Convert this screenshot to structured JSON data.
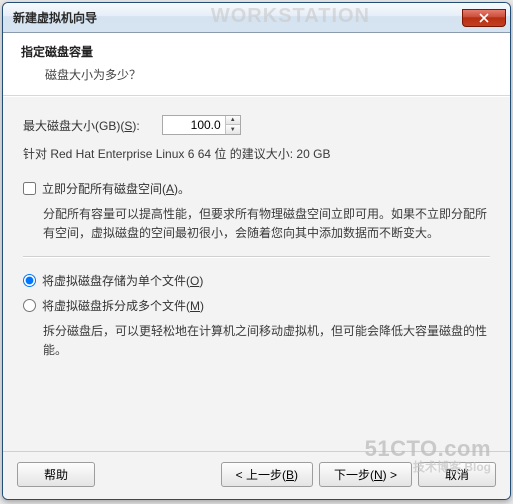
{
  "window": {
    "title": "新建虚拟机向导",
    "ghost": "WORKSTATION"
  },
  "header": {
    "heading": "指定磁盘容量",
    "sub": "磁盘大小为多少？"
  },
  "disk": {
    "label_prefix": "最大磁盘大小(GB)(",
    "label_hotkey": "S",
    "label_suffix": "):",
    "value": "100.0",
    "recommend": "针对 Red Hat Enterprise Linux 6 64 位 的建议大小: 20 GB"
  },
  "allocate": {
    "label_prefix": "立即分配所有磁盘空间(",
    "label_hotkey": "A",
    "label_suffix": ")。",
    "desc": "分配所有容量可以提高性能，但要求所有物理磁盘空间立即可用。如果不立即分配所有空间，虚拟磁盘的空间最初很小，会随着您向其中添加数据而不断变大。",
    "checked": false
  },
  "single": {
    "label_prefix": "将虚拟磁盘存储为单个文件(",
    "label_hotkey": "O",
    "label_suffix": ")",
    "checked": true
  },
  "split": {
    "label_prefix": "将虚拟磁盘拆分成多个文件(",
    "label_hotkey": "M",
    "label_suffix": ")",
    "desc": "拆分磁盘后，可以更轻松地在计算机之间移动虚拟机，但可能会降低大容量磁盘的性能。",
    "checked": false
  },
  "buttons": {
    "help": "帮助",
    "back_prefix": "< 上一步(",
    "back_hotkey": "B",
    "back_suffix": ")",
    "next_prefix": "下一步(",
    "next_hotkey": "N",
    "next_suffix": ") >",
    "cancel": "取消"
  },
  "watermark": {
    "big": "51CTO.com",
    "small": "技术博客 Blog"
  }
}
